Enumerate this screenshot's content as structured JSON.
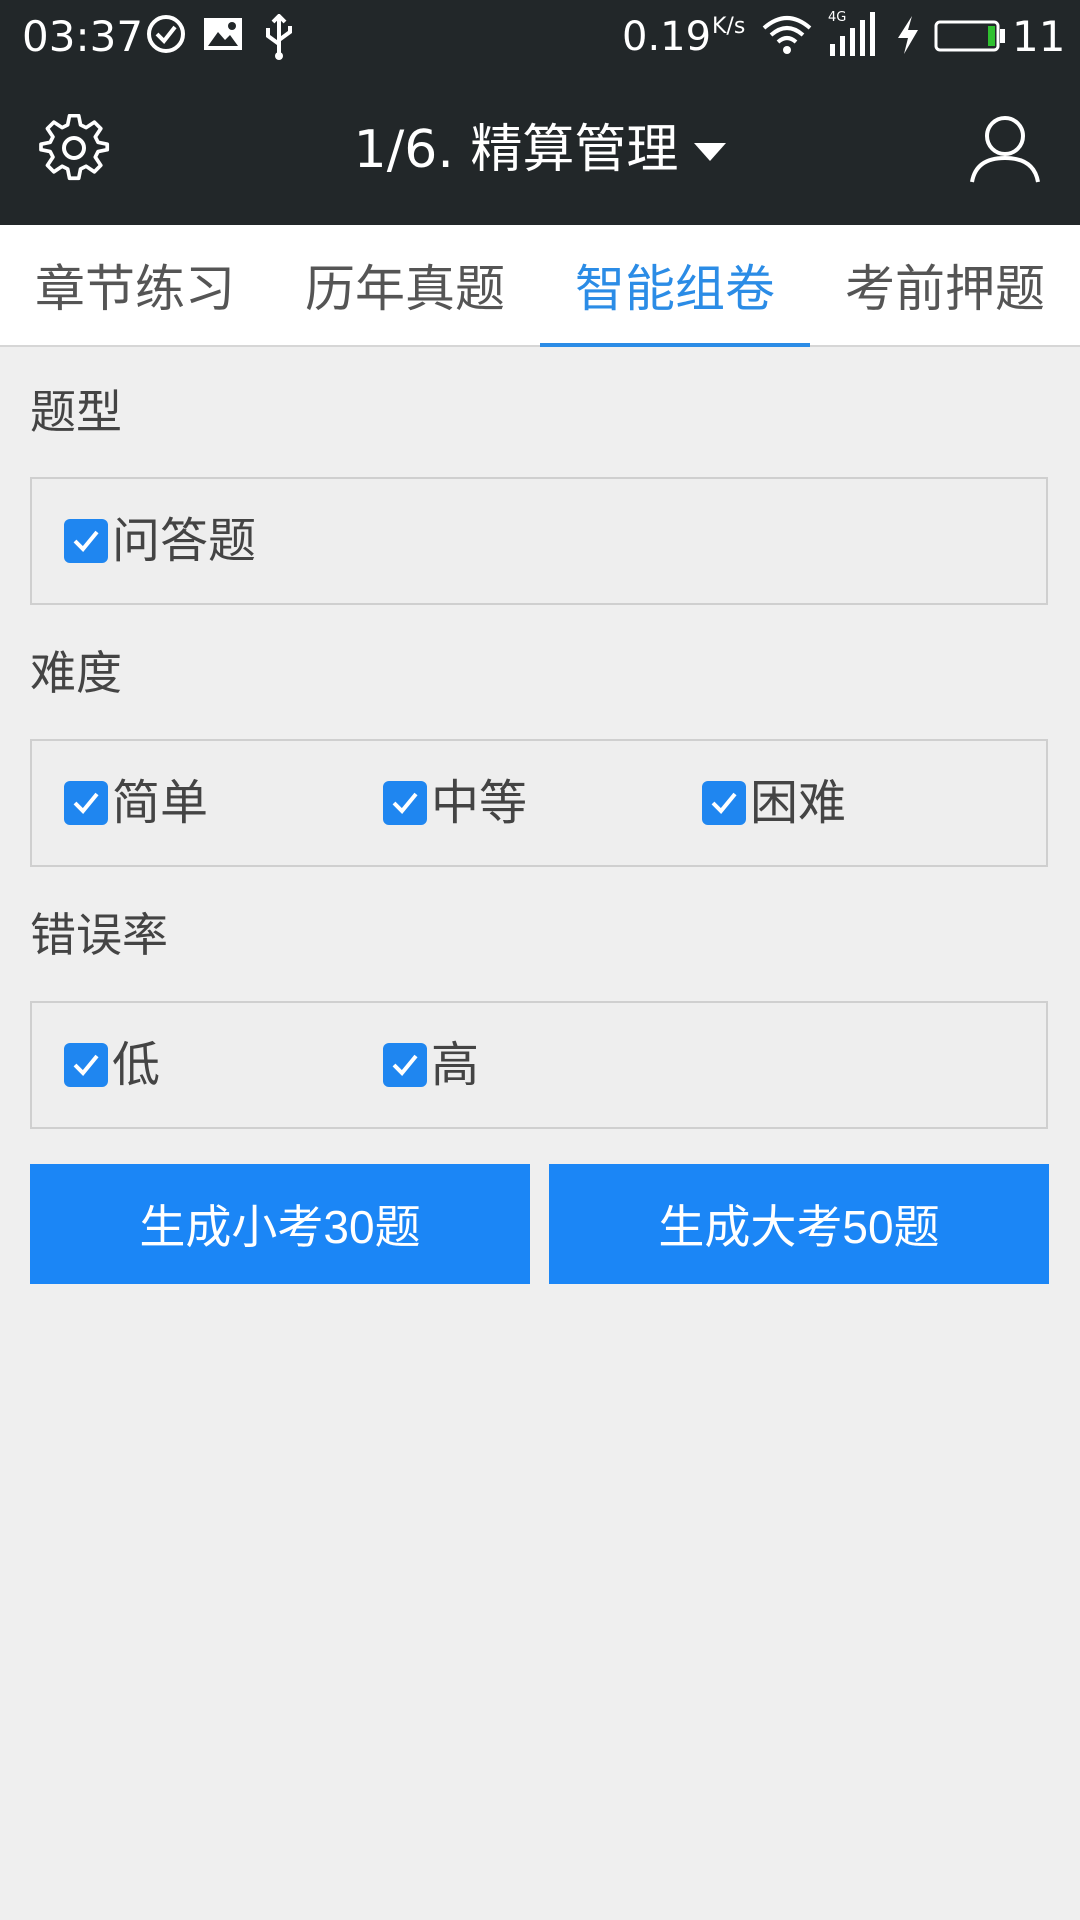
{
  "status_bar": {
    "time": "03:37",
    "network_speed": "0.19",
    "network_speed_unit": "K/s",
    "network_type": "4G",
    "battery_level": "11",
    "icons": [
      "check-circle-icon",
      "image-icon",
      "usb-icon",
      "wifi-icon",
      "signal-icon",
      "charging-icon",
      "battery-icon"
    ]
  },
  "app_bar": {
    "title": "1/6. 精算管理",
    "icons": [
      "gear-icon",
      "caret-down-icon",
      "user-icon"
    ]
  },
  "tabs": [
    {
      "label": "章节练习",
      "active": false
    },
    {
      "label": "历年真题",
      "active": false
    },
    {
      "label": "智能组卷",
      "active": true
    },
    {
      "label": "考前押题",
      "active": false
    }
  ],
  "question_type": {
    "label": "题型",
    "options": [
      {
        "label": "问答题",
        "checked": true
      }
    ]
  },
  "difficulty": {
    "label": "难度",
    "options": [
      {
        "label": "简单",
        "checked": true
      },
      {
        "label": "中等",
        "checked": true
      },
      {
        "label": "困难",
        "checked": true
      }
    ]
  },
  "error_rate": {
    "label": "错误率",
    "options": [
      {
        "label": "低",
        "checked": true
      },
      {
        "label": "高",
        "checked": true
      }
    ]
  },
  "buttons": {
    "small_exam": "生成小考30题",
    "big_exam": "生成大考50题"
  },
  "colors": {
    "app_bar_bg": "#222729",
    "accent": "#2b8ce6",
    "button_bg": "#1b86f6",
    "page_bg": "#efefef"
  }
}
